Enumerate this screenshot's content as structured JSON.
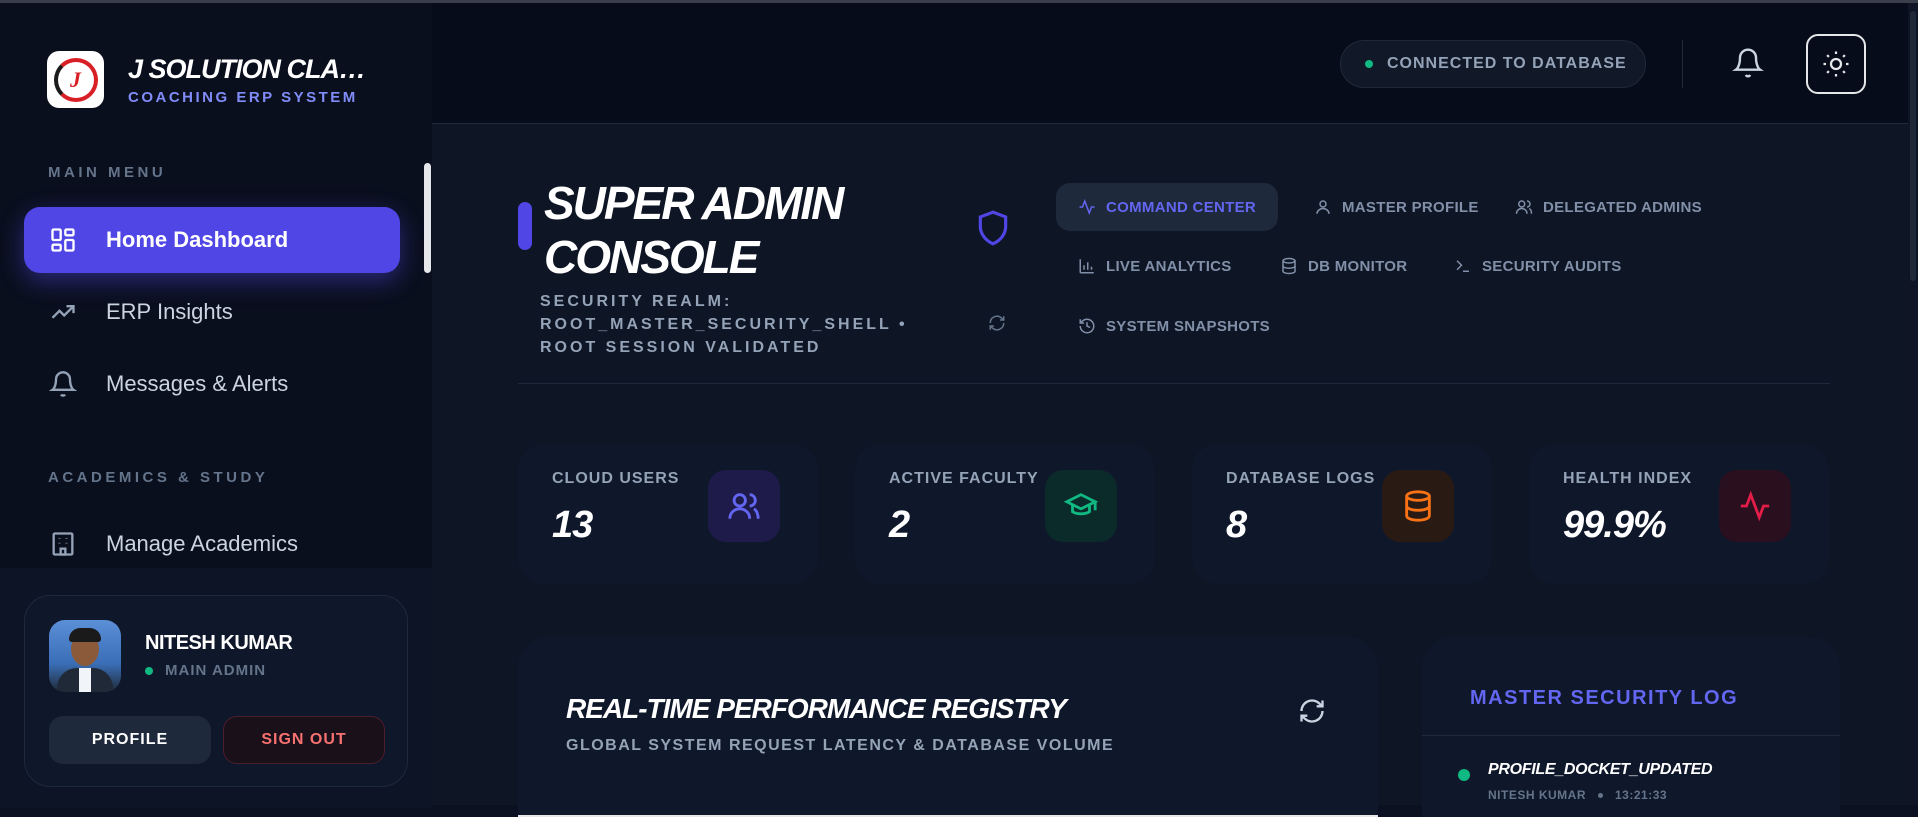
{
  "brand": {
    "title": "J SOLUTION CLASSES",
    "subtitle": "COACHING ERP SYSTEM",
    "logo_letter": "J"
  },
  "sidebar": {
    "sections": [
      "MAIN MENU",
      "ACADEMICS & STUDY"
    ],
    "items": [
      {
        "label": "Home Dashboard",
        "icon": "dashboard-icon",
        "active": true
      },
      {
        "label": "ERP Insights",
        "icon": "trending-up-icon"
      },
      {
        "label": "Messages & Alerts",
        "icon": "bell-icon"
      },
      {
        "label": "Manage Academics",
        "icon": "building-icon"
      }
    ]
  },
  "user": {
    "name": "NITESH KUMAR",
    "role": "MAIN ADMIN",
    "profile_label": "PROFILE",
    "signout_label": "SIGN OUT"
  },
  "topbar": {
    "db_status": "CONNECTED TO DATABASE",
    "status_color": "#10b981"
  },
  "console": {
    "title": "SUPER ADMIN CONSOLE",
    "realm_line1": "SECURITY REALM:",
    "realm_line2": "ROOT_MASTER_SECURITY_SHELL •",
    "realm_line3": "ROOT SESSION VALIDATED"
  },
  "tabs": [
    {
      "label": "COMMAND CENTER",
      "icon": "activity-icon",
      "active": true
    },
    {
      "label": "MASTER PROFILE",
      "icon": "user-icon"
    },
    {
      "label": "DELEGATED ADMINS",
      "icon": "users-icon"
    },
    {
      "label": "LIVE ANALYTICS",
      "icon": "bar-chart-icon"
    },
    {
      "label": "DB MONITOR",
      "icon": "database-icon"
    },
    {
      "label": "SECURITY AUDITS",
      "icon": "terminal-icon"
    },
    {
      "label": "SYSTEM SNAPSHOTS",
      "icon": "history-icon"
    }
  ],
  "stats": [
    {
      "label": "CLOUD USERS",
      "value": "13",
      "icon": "users-icon",
      "color": "#6366f1"
    },
    {
      "label": "ACTIVE FACULTY",
      "value": "2",
      "icon": "graduation-cap-icon",
      "color": "#10b981"
    },
    {
      "label": "DATABASE LOGS",
      "value": "8",
      "icon": "database-icon",
      "color": "#f97316"
    },
    {
      "label": "HEALTH INDEX",
      "value": "99.9%",
      "icon": "pulse-icon",
      "color": "#e11d48"
    }
  ],
  "performance": {
    "title": "REAL-TIME PERFORMANCE REGISTRY",
    "subtitle": "GLOBAL SYSTEM REQUEST LATENCY & DATABASE VOLUME"
  },
  "security_log": {
    "title": "MASTER SECURITY LOG",
    "entries": [
      {
        "event": "PROFILE_DOCKET_UPDATED",
        "user": "NITESH KUMAR",
        "time": "13:21:33"
      }
    ]
  }
}
